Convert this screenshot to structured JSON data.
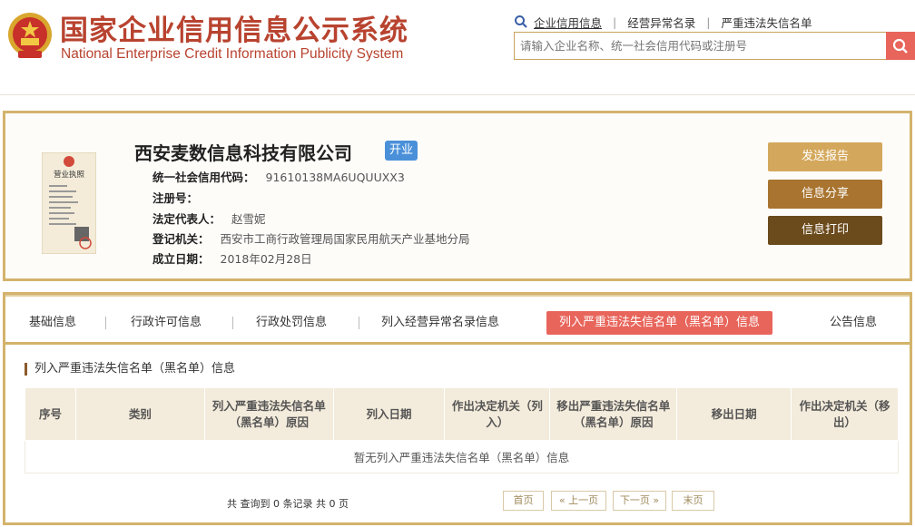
{
  "header": {
    "title_cn": "国家企业信用信息公示系统",
    "title_en": "National Enterprise Credit Information Publicity System",
    "links": [
      {
        "label": "企业信用信息",
        "active": true
      },
      {
        "label": "经营异常名录",
        "active": false
      },
      {
        "label": "严重违法失信名单",
        "active": false
      }
    ],
    "search": {
      "placeholder": "请输入企业名称、统一社会信用代码或注册号",
      "value": ""
    }
  },
  "company": {
    "name": "西安麦数信息科技有限公司",
    "status": "开业",
    "license_title": "营业执照",
    "fields": [
      {
        "key": "统一社会信用代码：",
        "value": "91610138MA6UQUUXX3"
      },
      {
        "key": "注册号：",
        "value": ""
      },
      {
        "key": "法定代表人：",
        "value": "赵雪妮"
      },
      {
        "key": "登记机关：",
        "value": "西安市工商行政管理局国家民用航天产业基地分局"
      },
      {
        "key": "成立日期：",
        "value": "2018年02月28日"
      }
    ],
    "buttons": {
      "send": "发送报告",
      "share": "信息分享",
      "print": "信息打印"
    }
  },
  "tabs": [
    {
      "label": "基础信息",
      "active": false
    },
    {
      "label": "行政许可信息",
      "active": false
    },
    {
      "label": "行政处罚信息",
      "active": false
    },
    {
      "label": "列入经营异常名录信息",
      "active": false
    },
    {
      "label": "列入严重违法失信名单（黑名单）信息",
      "active": true
    },
    {
      "label": "公告信息",
      "active": false
    }
  ],
  "section": {
    "title": "列入严重违法失信名单（黑名单）信息",
    "columns": [
      "序号",
      "类别",
      "列入严重违法失信名单（黑名单）原因",
      "列入日期",
      "作出决定机关（列入）",
      "移出严重违法失信名单（黑名单）原因",
      "移出日期",
      "作出决定机关（移出）"
    ],
    "empty_text": "暂无列入严重违法失信名单（黑名单）信息"
  },
  "pagination": {
    "summary": "共 查询到 0 条记录 共 0 页",
    "first": "首页",
    "prev": "« 上一页",
    "next": "下一页 »",
    "last": "末页"
  },
  "colors": {
    "brand_red": "#b8432f",
    "gold": "#d3b36c",
    "active_tab": "#e8655b",
    "status_blue": "#4a90d9"
  }
}
